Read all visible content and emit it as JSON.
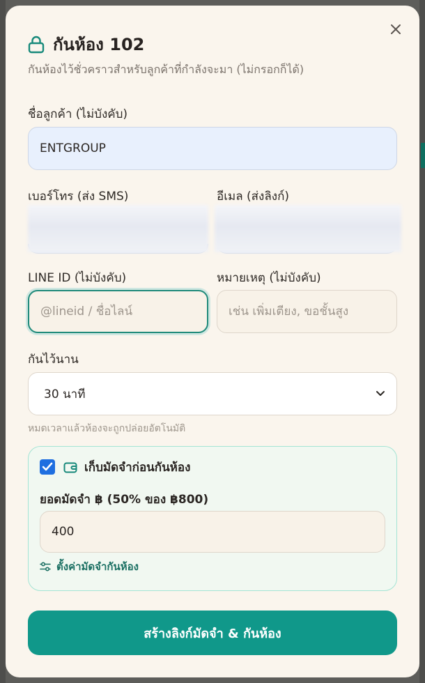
{
  "modal": {
    "title": "กันห้อง 102",
    "subtitle": "กันห้องไว้ชั่วคราวสำหรับลูกค้าที่กำลังจะมา (ไม่กรอกก็ได้)",
    "lock_icon": "lock-icon",
    "close_icon": "close-icon"
  },
  "form": {
    "customer_name": {
      "label": "ชื่อลูกค้า (ไม่บังคับ)",
      "value": "ENTGROUP"
    },
    "phone": {
      "label": "เบอร์โทร (ส่ง SMS)",
      "value": ""
    },
    "email": {
      "label": "อีเมล (ส่งลิงก์)",
      "value": ""
    },
    "line_id": {
      "label": "LINE ID (ไม่บังคับ)",
      "value": "",
      "placeholder": "@lineid / ชื่อไลน์"
    },
    "note": {
      "label": "หมายเหตุ (ไม่บังคับ)",
      "value": "",
      "placeholder": "เช่น เพิ่มเตียง, ขอชั้นสูง"
    },
    "duration": {
      "label": "กันไว้นาน",
      "selected": "30 นาที",
      "hint": "หมดเวลาแล้วห้องจะถูกปล่อยอัตโนมัติ"
    }
  },
  "deposit": {
    "checkbox_checked": true,
    "title": "เก็บมัดจำก่อนกันห้อง",
    "wallet_icon": "wallet-icon",
    "amount_label": "ยอดมัดจำ ฿ (50% ของ ฿800)",
    "amount_value": "400",
    "settings_link": "ตั้งค่ามัดจำกันห้อง",
    "settings_icon": "sliders-icon"
  },
  "actions": {
    "submit_label": "สร้างลิงก์มัดจำ & กันห้อง"
  },
  "colors": {
    "accent": "#10988a",
    "accent_dark": "#1a6f62",
    "modal_bg": "#faf5ed",
    "checkbox": "#1f6fe0"
  }
}
